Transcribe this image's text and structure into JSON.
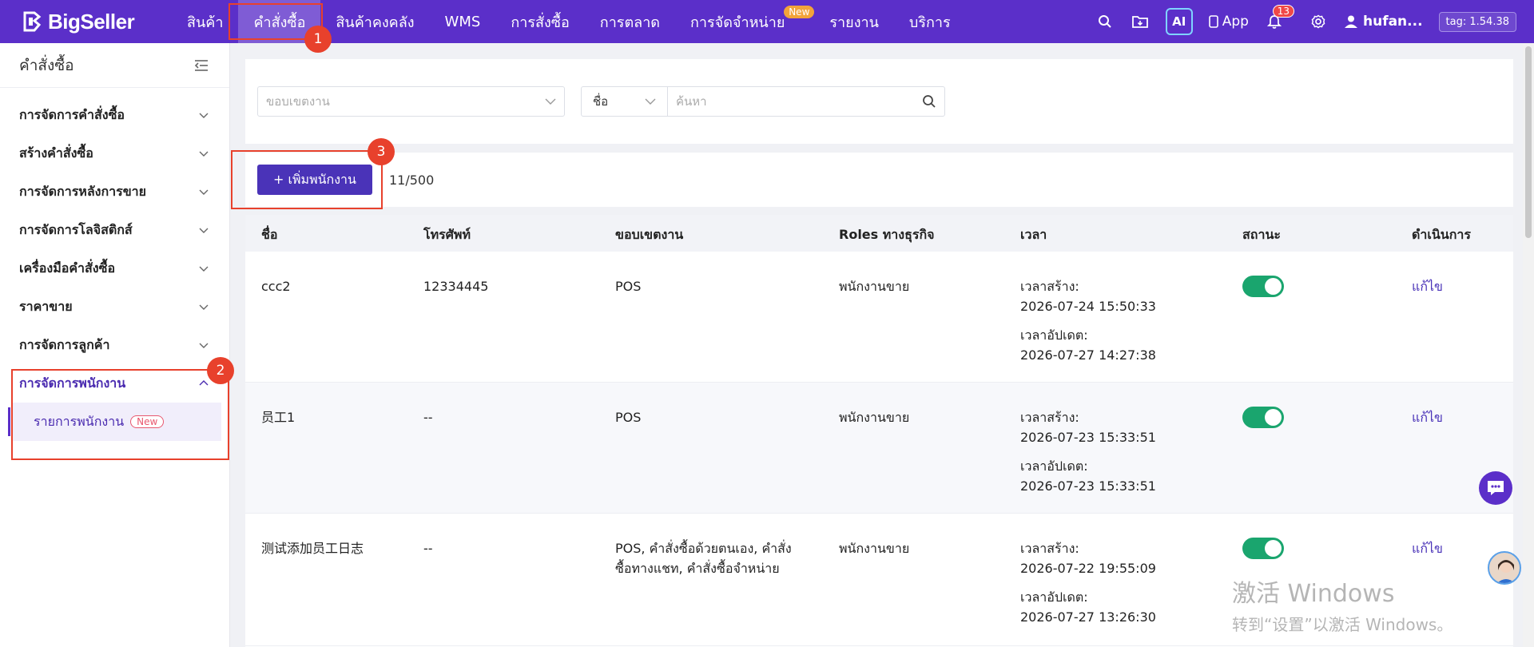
{
  "brand": {
    "name": "BigSeller"
  },
  "nav": {
    "items": [
      {
        "label": "สินค้า"
      },
      {
        "label": "คำสั่งซื้อ"
      },
      {
        "label": "สินค้าคงคลัง"
      },
      {
        "label": "WMS"
      },
      {
        "label": "การสั่งซื้อ"
      },
      {
        "label": "การตลาด"
      },
      {
        "label": "การจัดจำหน่าย",
        "badge": "New"
      },
      {
        "label": "รายงาน"
      },
      {
        "label": "บริการ"
      }
    ],
    "active_index": 1
  },
  "topbar": {
    "ai_label": "AI",
    "app_label": "App",
    "notification_count": "13",
    "user_name": "hufan...",
    "tag": "tag: 1.54.38"
  },
  "sidebar": {
    "title": "คำสั่งซื้อ",
    "items": [
      {
        "label": "การจัดการคำสั่งซื้อ"
      },
      {
        "label": "สร้างคำสั่งซื้อ"
      },
      {
        "label": "การจัดการหลังการขาย"
      },
      {
        "label": "การจัดการโลจิสติกส์"
      },
      {
        "label": "เครื่องมือคำสั่งซื้อ"
      },
      {
        "label": "ราคาขาย"
      },
      {
        "label": "การจัดการลูกค้า"
      },
      {
        "label": "การจัดการพนักงาน"
      }
    ],
    "sub_item": {
      "label": "รายการพนักงาน",
      "badge": "New"
    }
  },
  "filters": {
    "scope_placeholder": "ขอบเขตงาน",
    "search_type": "ชื่อ",
    "search_placeholder": "ค้นหา"
  },
  "toolbar": {
    "add_label": "+ เพิ่มพนักงาน",
    "count": "11/500"
  },
  "table": {
    "headers": [
      "ชื่อ",
      "โทรศัพท์",
      "ขอบเขตงาน",
      "Roles ทางธุรกิจ",
      "เวลา",
      "สถานะ",
      "ดำเนินการ"
    ],
    "rows": [
      {
        "name": "ccc2",
        "phone": "12334445",
        "scope": "POS",
        "role": "พนักงานขาย",
        "created_label": "เวลาสร้าง:",
        "created": "2026-07-24 15:50:33",
        "updated_label": "เวลาอัปเดต:",
        "updated": "2026-07-27 14:27:38",
        "status_on": true,
        "action": "แก้ไข"
      },
      {
        "name": "员工1",
        "phone": "--",
        "scope": "POS",
        "role": "พนักงานขาย",
        "created_label": "เวลาสร้าง:",
        "created": "2026-07-23 15:33:51",
        "updated_label": "เวลาอัปเดต:",
        "updated": "2026-07-23 15:33:51",
        "status_on": true,
        "action": "แก้ไข"
      },
      {
        "name": "测试添加员工日志",
        "phone": "--",
        "scope": "POS, คำสั่งซื้อด้วยตนเอง, คำสั่งซื้อทางแชท, คำสั่งซื้อจำหน่าย",
        "role": "พนักงานขาย",
        "created_label": "เวลาสร้าง:",
        "created": "2026-07-22 19:55:09",
        "updated_label": "เวลาอัปเดต:",
        "updated": "2026-07-27 13:26:30",
        "status_on": true,
        "action": "แก้ไข"
      }
    ]
  },
  "callouts": [
    "1",
    "2",
    "3"
  ],
  "watermark": {
    "line1": "激活 Windows",
    "line2": "转到“设置”以激活 Windows。"
  },
  "colors": {
    "brand": "#5b2fc9",
    "accent": "#4a33b8",
    "callout": "#e8412c",
    "toggle_on": "#1aa56e"
  }
}
